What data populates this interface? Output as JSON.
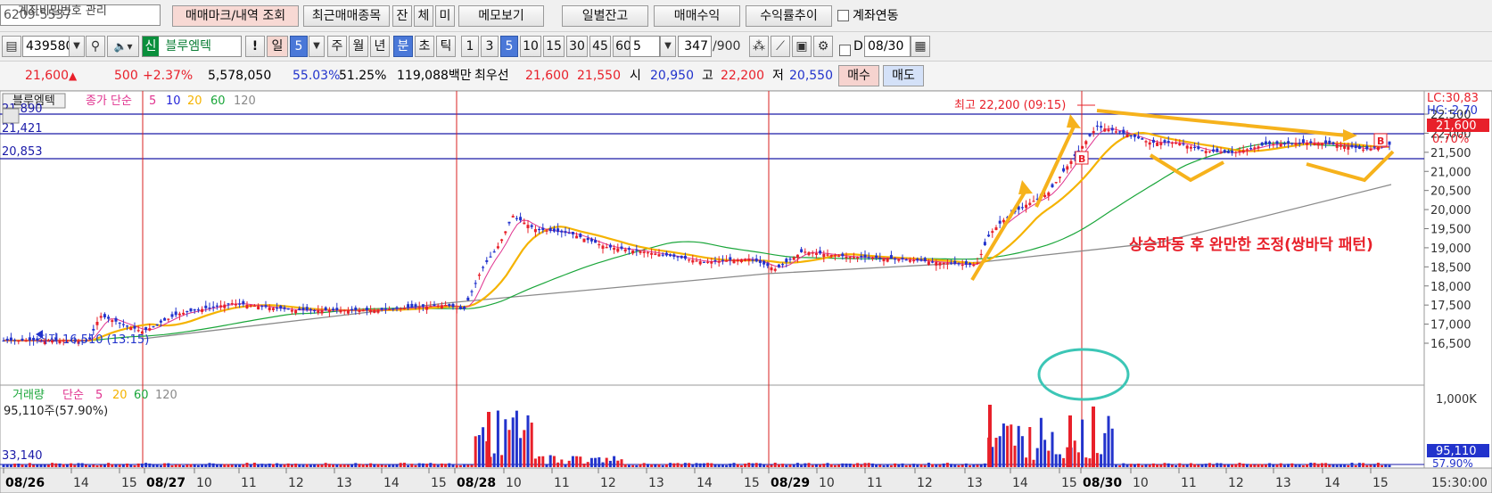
{
  "toolbar1": {
    "account_masked": "6209-5537",
    "password_manage_label": "계좌비밀번호 관리",
    "trade_mark_btn": "매매마크/내역 조회",
    "recent_items_btn": "최근매매종목",
    "tab_jan": "잔",
    "tab_che": "체",
    "tab_mi": "미",
    "memo_btn": "메모보기",
    "daily_balance_btn": "일별잔고",
    "trade_profit_btn": "매매수익",
    "return_trend_btn": "수익률추이",
    "account_link_label": "계좌연동"
  },
  "toolbar2": {
    "stock_code": "439580",
    "credit_badge": "신",
    "stock_name": "블루엠텍",
    "warn_mark": "!",
    "period_day": "일",
    "period_value": "5",
    "period_week": "주",
    "period_month": "월",
    "period_year": "년",
    "period_minute": "분",
    "period_second": "초",
    "period_tick": "틱",
    "minute_buttons": [
      "1",
      "3",
      "5",
      "10",
      "15",
      "30",
      "45",
      "60"
    ],
    "selected_minute": "5",
    "count_value": "5",
    "bar_count": "347",
    "bar_total": "/900",
    "d_label": "D",
    "date_value": "08/30"
  },
  "quote": {
    "price": "21,600",
    "up_arrow": "▲",
    "change": "500",
    "change_pct": "+2.37%",
    "volume": "5,578,050",
    "ratio1": "55.03%",
    "ratio2": "51.25%",
    "amount": "119,088백만",
    "best_label": "최우선",
    "ask": "21,600",
    "bid": "21,550",
    "open_label": "시",
    "open": "20,950",
    "high_label": "고",
    "high": "22,200",
    "low_label": "저",
    "low": "20,550",
    "buy_btn": "매수",
    "sell_btn": "매도"
  },
  "price_panel": {
    "stock_tag": "블루엠텍",
    "ma_label": "종가 단순",
    "ma_periods": [
      "5",
      "10",
      "20",
      "60",
      "120"
    ],
    "ma_colors": [
      "#e0338f",
      "#2424d8",
      "#f5b300",
      "#1aa63a",
      "#8a8a8a"
    ],
    "left_levels": [
      "21,890",
      "21,421",
      "20,853"
    ],
    "max_annotation": "최고 22,200 (09:15)",
    "min_annotation": "최저 16,510 (13:15)",
    "lc_label": "LC:30,83",
    "hc_label": "HC:-2,70",
    "current_price_tag": "21,600",
    "current_pct_tag": "0.70%",
    "y_ticks": [
      "22,500",
      "22,000",
      "21,500",
      "21,000",
      "20,500",
      "20,000",
      "19,500",
      "19,000",
      "18,500",
      "18,000",
      "17,500",
      "17,000",
      "16,500"
    ],
    "marker_b": "B",
    "commentary": "상승파동 후 완만한 조정(쌍바닥 패턴)"
  },
  "volume_panel": {
    "title": "거래량",
    "ma_label": "단순",
    "ma_periods": [
      "5",
      "20",
      "60",
      "120"
    ],
    "ma_colors": [
      "#e0338f",
      "#f5b300",
      "#1aa63a",
      "#8a8a8a"
    ],
    "shares_info": "95,110주(57.90%)",
    "left_level": "33,140",
    "y_tick": "1,000K",
    "current_volume_tag": "95,110",
    "current_pct_tag": "57.90%"
  },
  "time_axis": {
    "labels": [
      "08/26",
      "14",
      "15",
      "08/27",
      "10",
      "11",
      "12",
      "13",
      "14",
      "15",
      "08/28",
      "10",
      "11",
      "12",
      "13",
      "14",
      "15",
      "08/29",
      "10",
      "11",
      "12",
      "13",
      "14",
      "15",
      "08/30",
      "10",
      "11",
      "12",
      "13",
      "14",
      "15"
    ],
    "date_labels": [
      "08/26",
      "08/27",
      "08/28",
      "08/29",
      "08/30"
    ],
    "end_time": "15:30:00"
  },
  "colors": {
    "up": "#e8202a",
    "down": "#2233cc",
    "hline": "#1a1aa8",
    "day_sep": "#d92020",
    "annotation": "#f6b21c",
    "circle": "#3cc6b6",
    "commentary": "#e8202a"
  }
}
